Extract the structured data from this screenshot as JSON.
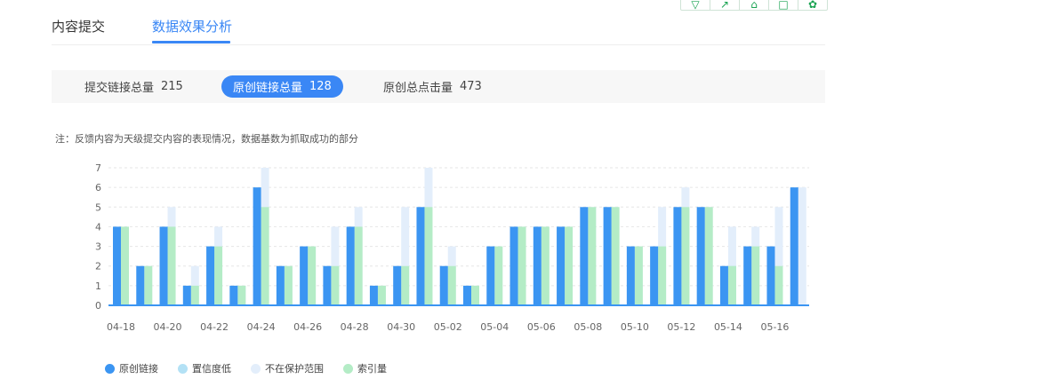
{
  "tabs": [
    {
      "label": "内容提交"
    },
    {
      "label": "数据效果分析"
    }
  ],
  "stats": [
    {
      "label": "提交链接总量",
      "value": "215"
    },
    {
      "label": "原创链接总量",
      "value": "128"
    },
    {
      "label": "原创总点击量",
      "value": "473"
    }
  ],
  "note": "注：反馈内容为天级提交内容的表现情况，数据基数为抓取成功的部分",
  "toolbar_icons": [
    "download-icon",
    "expand-icon",
    "home-icon",
    "window-icon",
    "settings-icon"
  ],
  "colors": {
    "accent": "#3a87f5",
    "series": [
      "#3b95f2",
      "#b3e1f5",
      "#e3eefb",
      "#b4ecc6"
    ]
  },
  "chart_data": {
    "type": "bar",
    "title": "",
    "xlabel": "",
    "ylabel": "",
    "ylim": [
      0,
      7
    ],
    "yticks": [
      0,
      1,
      2,
      3,
      4,
      5,
      6,
      7
    ],
    "grid": true,
    "legend_position": "bottom-left",
    "categories": [
      "04-18",
      "04-19",
      "04-20",
      "04-21",
      "04-22",
      "04-23",
      "04-24",
      "04-25",
      "04-26",
      "04-27",
      "04-28",
      "04-29",
      "04-30",
      "05-01",
      "05-02",
      "05-03",
      "05-04",
      "05-05",
      "05-06",
      "05-07",
      "05-08",
      "05-09",
      "05-10",
      "05-11",
      "05-12",
      "05-13",
      "05-14",
      "05-15",
      "05-16"
    ],
    "tick_labels": [
      "04-18",
      "04-20",
      "04-22",
      "04-24",
      "04-26",
      "04-28",
      "04-30",
      "05-02",
      "05-04",
      "05-06",
      "05-08",
      "05-10",
      "05-12",
      "05-14",
      "05-16"
    ],
    "series": [
      {
        "name": "原创链接",
        "values": [
          4,
          2,
          4,
          1,
          3,
          1,
          6,
          2,
          3,
          2,
          4,
          1,
          2,
          5,
          2,
          1,
          3,
          4,
          4,
          4,
          5,
          5,
          3,
          3,
          5,
          5,
          2,
          3,
          3,
          6
        ]
      },
      {
        "name": "置信度低",
        "values": [
          0,
          0,
          0,
          0,
          0,
          0,
          0,
          0,
          0,
          0,
          0,
          0,
          0,
          0,
          0,
          0,
          0,
          0,
          0,
          0,
          0,
          0,
          0,
          0,
          0,
          0,
          2,
          0,
          0,
          0
        ]
      },
      {
        "name": "不在保护范围",
        "values": [
          4,
          2,
          5,
          2,
          4,
          1,
          7,
          2,
          3,
          4,
          5,
          1,
          5,
          7,
          3,
          1,
          3,
          4,
          4,
          4,
          5,
          5,
          3,
          5,
          6,
          5,
          4,
          4,
          5,
          6
        ]
      },
      {
        "name": "索引量",
        "values": [
          4,
          2,
          4,
          1,
          3,
          1,
          5,
          2,
          3,
          2,
          4,
          1,
          2,
          5,
          2,
          1,
          3,
          4,
          4,
          4,
          5,
          5,
          3,
          3,
          5,
          5,
          2,
          3,
          2,
          0
        ]
      }
    ]
  }
}
